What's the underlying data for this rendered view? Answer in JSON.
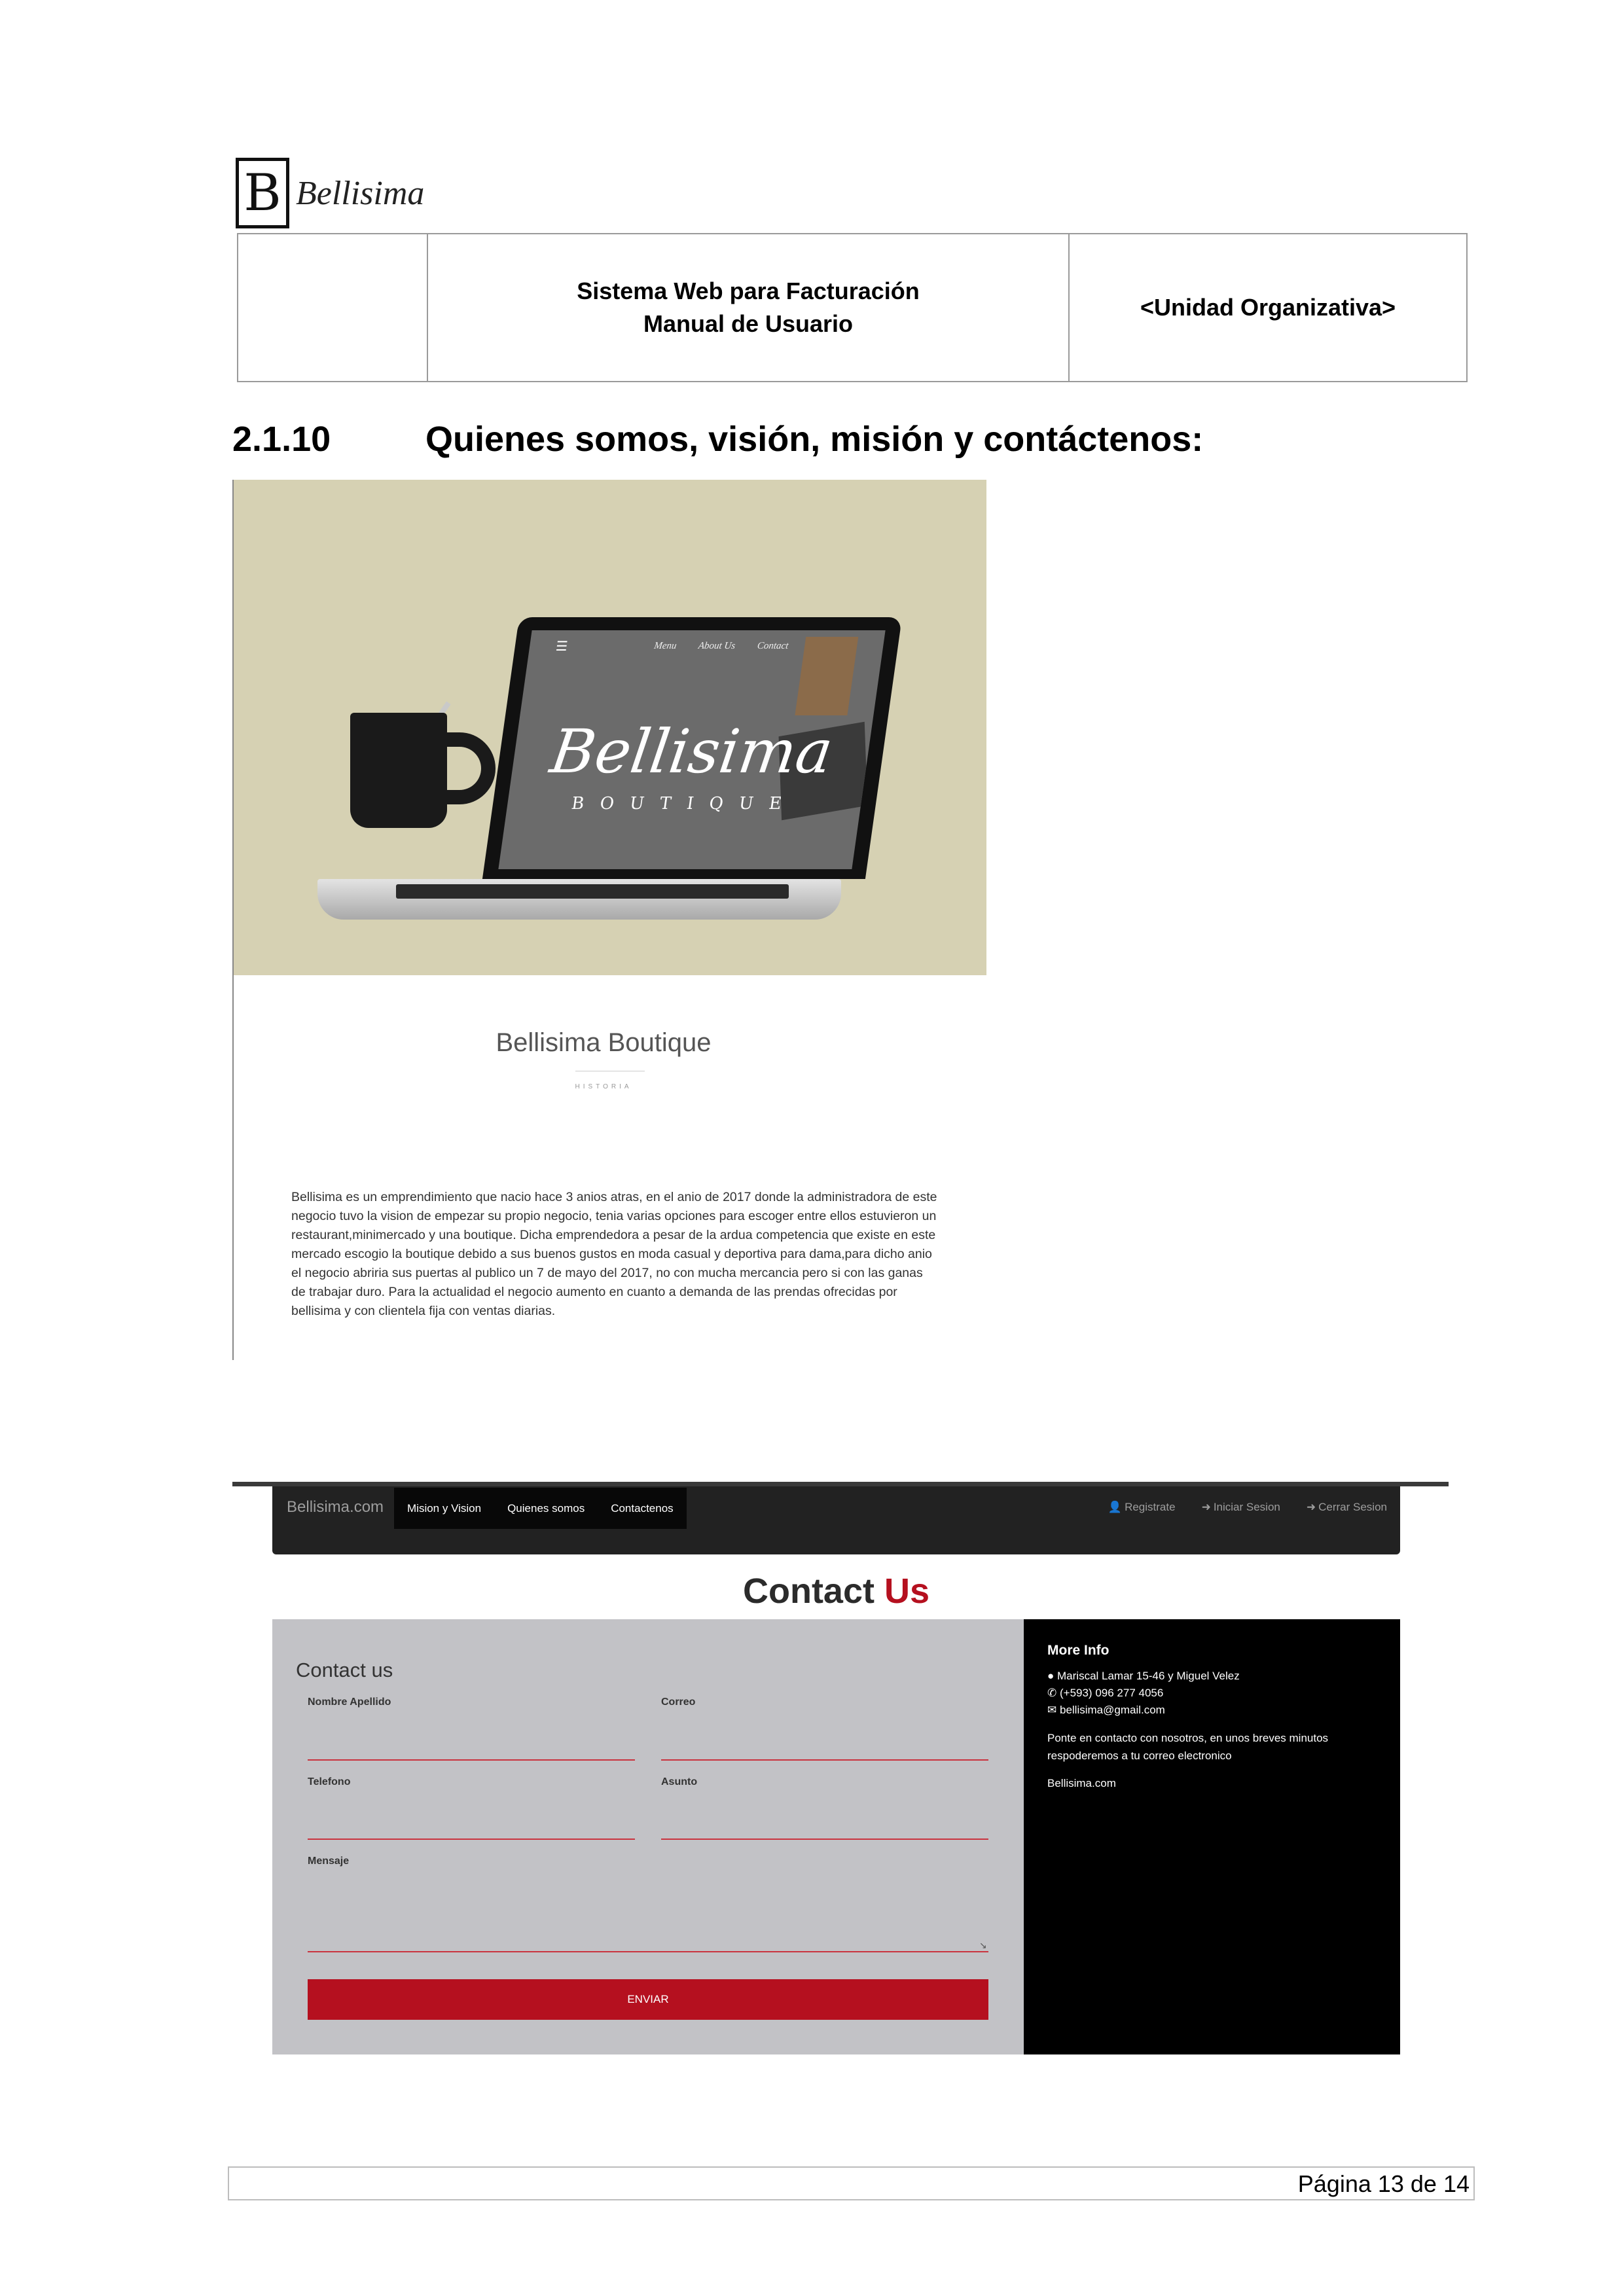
{
  "header": {
    "logo_letter": "B",
    "logo_name": "Bellisima",
    "system_title": "Sistema Web para Facturación",
    "manual_title": "Manual de Usuario",
    "unit": "<Unidad Organizativa>"
  },
  "section": {
    "number": "2.1.10",
    "title": "Quienes somos, visión, misión y contáctenos:"
  },
  "screenshot1": {
    "screen_nav": [
      "Menu",
      "About Us",
      "Contact"
    ],
    "screen_brand": "Bellisima",
    "screen_sub": "BOUTIQUE",
    "title": "Bellisima Boutique",
    "subtitle": "HISTORIA",
    "paragraph": "Bellisima es un emprendimiento que nacio hace 3 anios atras, en el anio de 2017 donde la administradora de este negocio tuvo la vision de empezar su propio negocio, tenia varias opciones para escoger entre ellos estuvieron un restaurant,minimercado y una boutique. Dicha emprendedora a pesar de la ardua competencia que existe en este mercado escogio la boutique debido a sus buenos gustos en moda casual y deportiva para dama,para dicho anio el negocio abriria sus puertas al publico un 7 de mayo del 2017, no con mucha mercancia pero si con las ganas de trabajar duro. Para la actualidad el negocio aumento en cuanto a demanda de las prendas ofrecidas por bellisima y con clientela fija con ventas diarias."
  },
  "screenshot2": {
    "nav": {
      "brand": "Bellisima.com",
      "tabs": [
        "Mision y Vision",
        "Quienes somos",
        "Contactenos"
      ],
      "register": "Registrate",
      "login": "Iniciar Sesion",
      "logout": "Cerrar Sesion"
    },
    "heading_main": "Contact ",
    "heading_accent": "Us",
    "form": {
      "title": "Contact us",
      "name_label": "Nombre Apellido",
      "email_label": "Correo",
      "phone_label": "Telefono",
      "subject_label": "Asunto",
      "message_label": "Mensaje",
      "submit": "ENVIAR"
    },
    "info": {
      "title": "More Info",
      "address": "Mariscal Lamar 15-46 y Miguel Velez",
      "phone": "(+593) 096 277 4056",
      "email": "bellisima@gmail.com",
      "message": "Ponte en contacto con nosotros, en unos breves minutos respoderemos a tu correo electronico",
      "site": "Bellisima.com"
    }
  },
  "footer": {
    "page": "Página 13 de 14"
  },
  "colors": {
    "accent_red": "#b5101f",
    "navbar": "#222222",
    "form_panel": "#c2c2c6",
    "hero_bg": "#d6d1b3"
  },
  "icons": [
    "map-marker-icon",
    "phone-icon",
    "envelope-icon",
    "user-icon",
    "login-icon",
    "logout-icon",
    "menu-icon"
  ]
}
